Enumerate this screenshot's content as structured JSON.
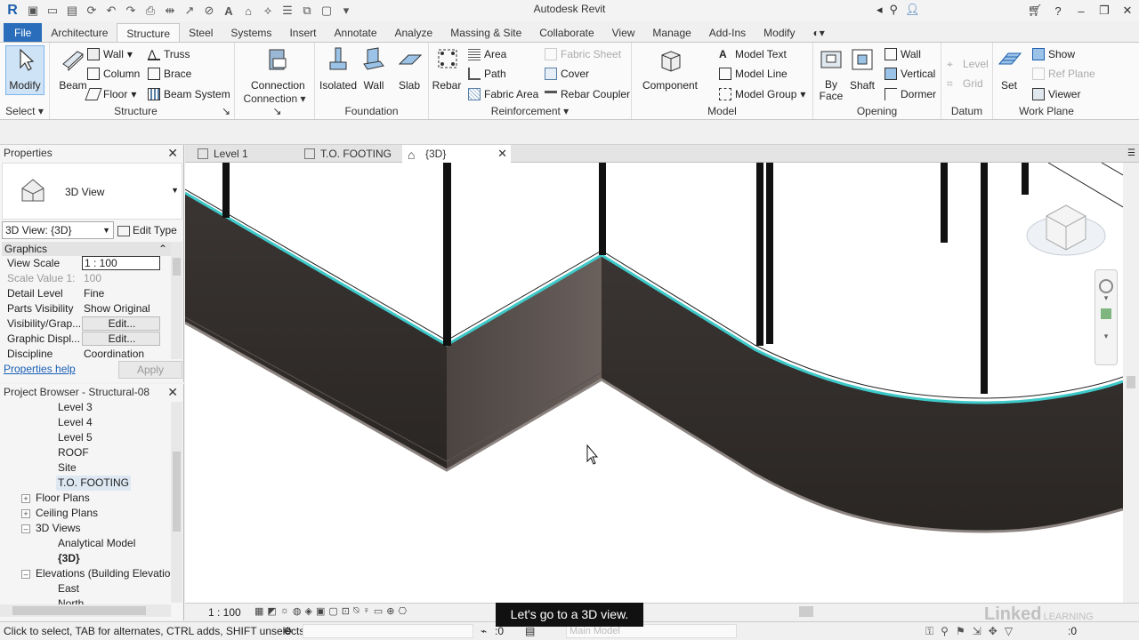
{
  "app_title": "Autodesk Revit",
  "tabs": [
    {
      "label": "File"
    },
    {
      "label": "Architecture"
    },
    {
      "label": "Structure"
    },
    {
      "label": "Steel"
    },
    {
      "label": "Systems"
    },
    {
      "label": "Insert"
    },
    {
      "label": "Annotate"
    },
    {
      "label": "Analyze"
    },
    {
      "label": "Massing & Site"
    },
    {
      "label": "Collaborate"
    },
    {
      "label": "View"
    },
    {
      "label": "Manage"
    },
    {
      "label": "Add-Ins"
    },
    {
      "label": "Modify"
    }
  ],
  "ribbon": {
    "select": {
      "modify": "Modify",
      "panel": "Select"
    },
    "structure": {
      "beam": "Beam",
      "wall": "Wall",
      "column": "Column",
      "floor": "Floor",
      "truss": "Truss",
      "brace": "Brace",
      "beam_system": "Beam  System",
      "panel": "Structure"
    },
    "connection": {
      "connection": "Connection",
      "panel": "Connection"
    },
    "foundation": {
      "isolated": "Isolated",
      "wall": "Wall",
      "slab": "Slab",
      "panel": "Foundation"
    },
    "reinforcement": {
      "rebar": "Rebar",
      "area": "Area",
      "path": "Path",
      "fabric_area": "Fabric  Area",
      "fabric_sheet": "Fabric  Sheet",
      "cover": "Cover",
      "rebar_coupler": "Rebar  Coupler",
      "panel": "Reinforcement"
    },
    "model": {
      "component": "Component",
      "model_text": "Model  Text",
      "model_line": "Model  Line",
      "model_group": "Model  Group",
      "panel": "Model"
    },
    "opening": {
      "by_face": "By",
      "by_face2": "Face",
      "shaft": "Shaft",
      "wall": "Wall",
      "vertical": "Vertical",
      "dormer": "Dormer",
      "panel": "Opening"
    },
    "datum": {
      "level": "Level",
      "grid": "Grid",
      "panel": "Datum"
    },
    "work_plane": {
      "set": "Set",
      "show": "Show",
      "ref_plane": "Ref  Plane",
      "viewer": "Viewer",
      "panel": "Work Plane"
    }
  },
  "properties": {
    "title": "Properties",
    "type_name": "3D View",
    "view_selector": "3D View: {3D}",
    "edit_type": "Edit Type",
    "group": "Graphics",
    "rows": [
      {
        "key": "View Scale",
        "value": "1 : 100"
      },
      {
        "key": "Scale Value    1:",
        "value": "100"
      },
      {
        "key": "Detail Level",
        "value": "Fine"
      },
      {
        "key": "Parts Visibility",
        "value": "Show Original"
      },
      {
        "key": "Visibility/Grap...",
        "value": "Edit..."
      },
      {
        "key": "Graphic Displ...",
        "value": "Edit..."
      },
      {
        "key": "Discipline",
        "value": "Coordination"
      }
    ],
    "help": "Properties help",
    "apply": "Apply"
  },
  "browser": {
    "title": "Project Browser - Structural-08",
    "items": [
      {
        "label": "Level 3"
      },
      {
        "label": "Level 4"
      },
      {
        "label": "Level 5"
      },
      {
        "label": "ROOF"
      },
      {
        "label": "Site"
      },
      {
        "label": "T.O. FOOTING"
      },
      {
        "label": "Floor Plans"
      },
      {
        "label": "Ceiling Plans"
      },
      {
        "label": "3D Views"
      },
      {
        "label": "Analytical Model"
      },
      {
        "label": "{3D}"
      },
      {
        "label": "Elevations (Building Elevation"
      },
      {
        "label": "East"
      },
      {
        "label": "North"
      }
    ]
  },
  "view_tabs": [
    {
      "label": "Level 1"
    },
    {
      "label": "T.O. FOOTING"
    },
    {
      "label": "{3D}"
    }
  ],
  "viewbar": {
    "scale": "1 : 100"
  },
  "status": {
    "text": "Click to select, TAB for alternates, CTRL adds, SHIFT unselects.",
    "main_model": "Main Model",
    "zero1": ":0",
    "zero2": ":0"
  },
  "caption": "Let's go to a 3D view.",
  "watermark": "Linked",
  "watermark2": "LEARNING",
  "colors": {
    "file_tab": "#2a6ebb",
    "wall_edge": "#3ec9c9"
  }
}
